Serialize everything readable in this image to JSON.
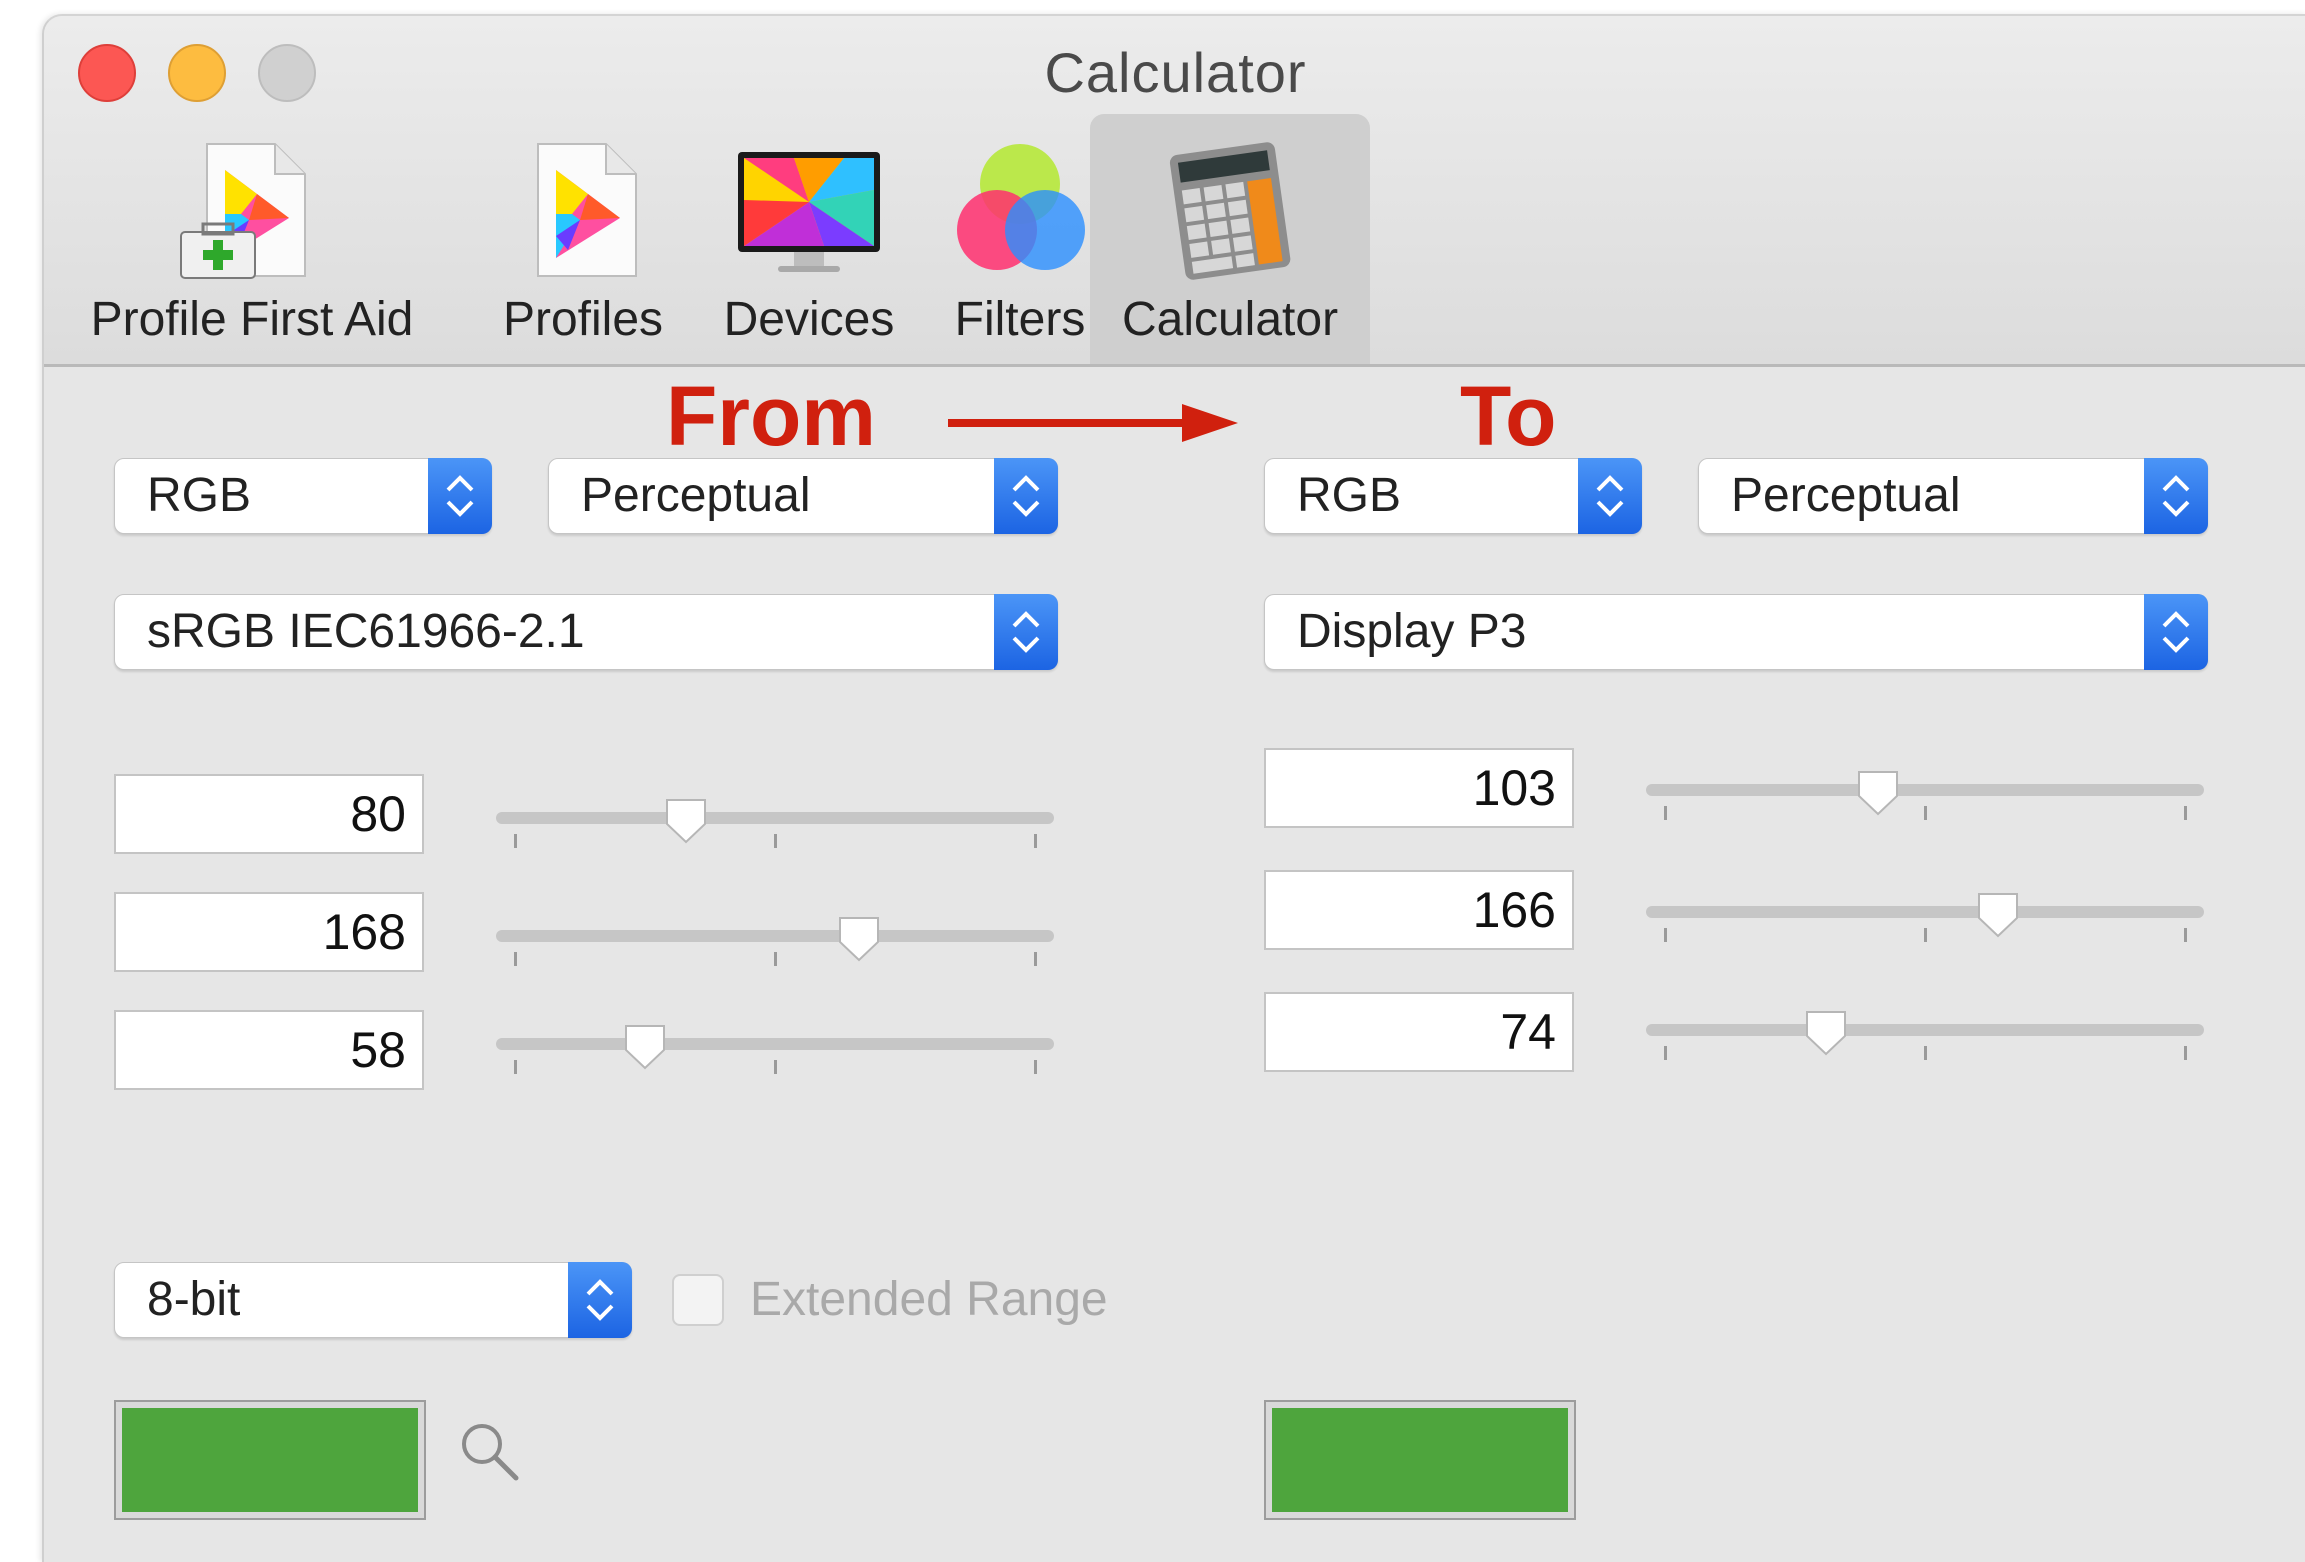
{
  "window": {
    "title": "Calculator"
  },
  "toolbar": {
    "items": [
      {
        "label": "Profile First Aid",
        "icon": "profile-first-aid-icon"
      },
      {
        "label": "Profiles",
        "icon": "profiles-icon"
      },
      {
        "label": "Devices",
        "icon": "display-icon"
      },
      {
        "label": "Filters",
        "icon": "color-filters-icon"
      },
      {
        "label": "Calculator",
        "icon": "calculator-icon",
        "selected": true
      }
    ]
  },
  "annotation": {
    "from_label": "From",
    "to_label": "To",
    "color": "#d0200e"
  },
  "from": {
    "color_space": "RGB",
    "intent": "Perceptual",
    "profile": "sRGB IEC61966-2.1",
    "values": [
      "80",
      "168",
      "58"
    ],
    "slider_levels": [
      0.33,
      0.66,
      0.25
    ],
    "swatch_color": "#4ea53d"
  },
  "to": {
    "color_space": "RGB",
    "intent": "Perceptual",
    "profile": "Display P3",
    "values": [
      "103",
      "166",
      "74"
    ],
    "slider_levels": [
      0.41,
      0.64,
      0.31
    ],
    "swatch_color": "#4ea53d"
  },
  "bit_depth": "8-bit",
  "extended_range": {
    "label": "Extended Range",
    "checked": false,
    "enabled": false
  },
  "colors": {
    "accent": "#2a78f0",
    "window_bg": "#e6e6e6"
  }
}
